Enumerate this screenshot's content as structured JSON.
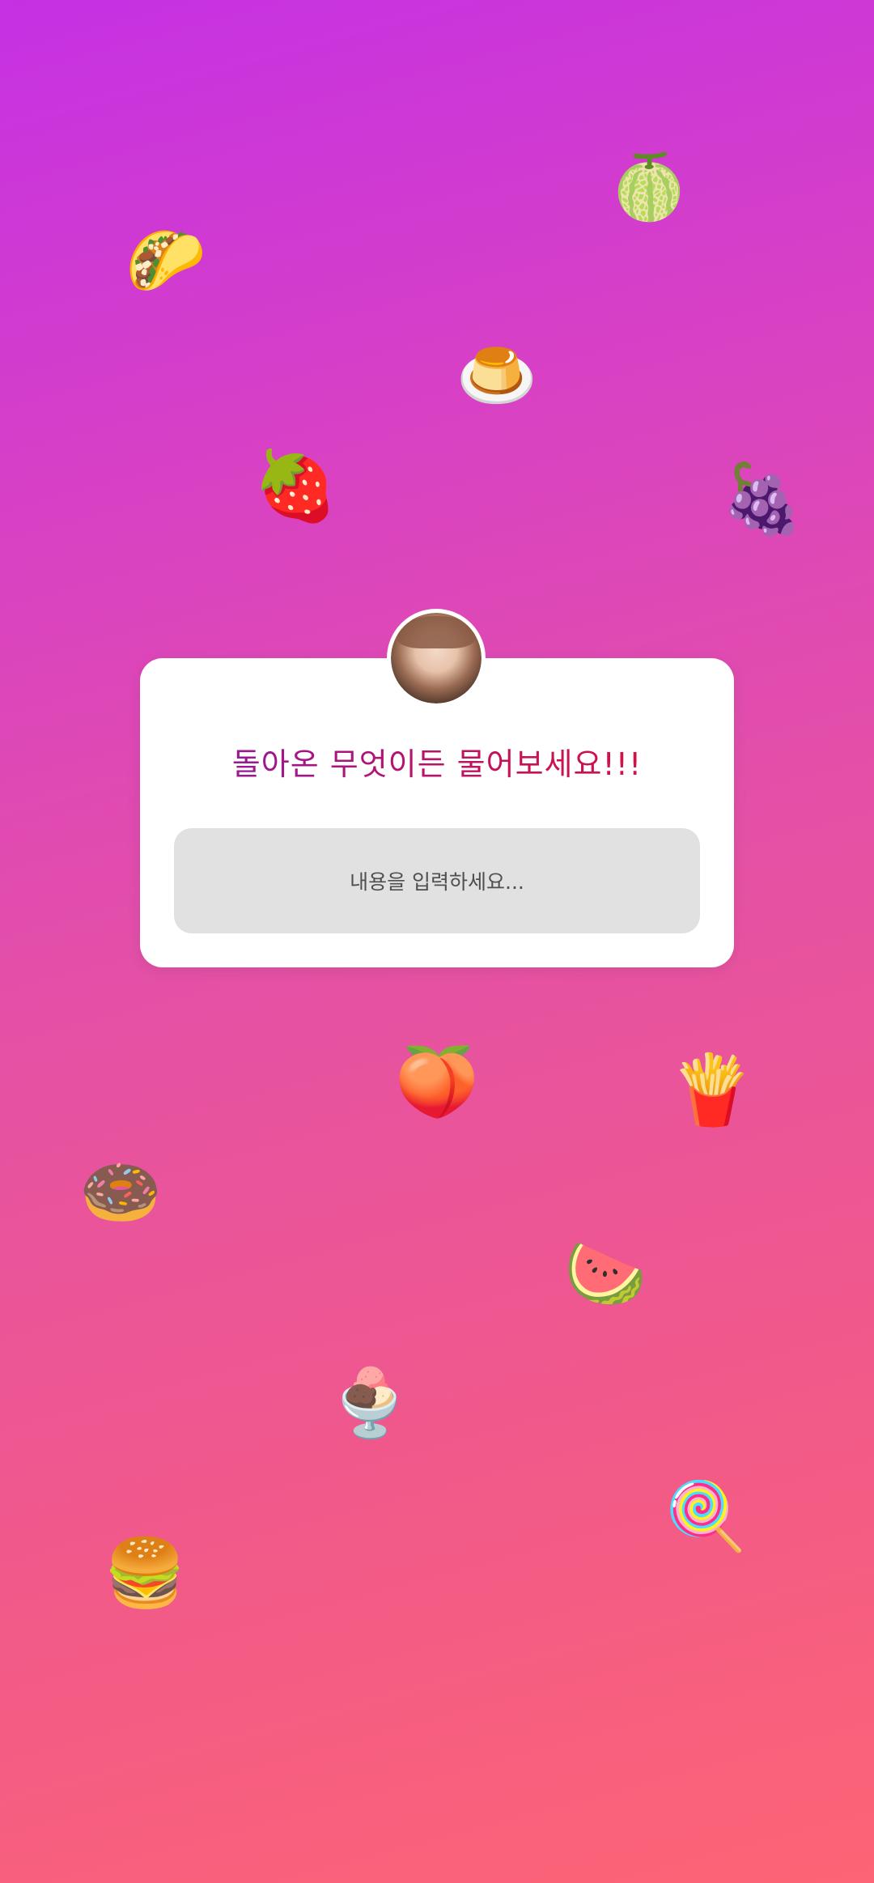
{
  "question_card": {
    "title": "돌아온 무엇이든 물어보세요!!!",
    "input_placeholder": "내용을 입력하세요..."
  },
  "avatar": {
    "name": "avatar"
  },
  "decorations": [
    {
      "icon": "melon-emoji-icon",
      "glyph": "🍈"
    },
    {
      "icon": "taco-emoji-icon",
      "glyph": "🌮"
    },
    {
      "icon": "pudding-emoji-icon",
      "glyph": "🍮"
    },
    {
      "icon": "strawberry-emoji-icon",
      "glyph": "🍓"
    },
    {
      "icon": "grapes-emoji-icon",
      "glyph": "🍇"
    },
    {
      "icon": "peach-emoji-icon",
      "glyph": "🍑"
    },
    {
      "icon": "fries-emoji-icon",
      "glyph": "🍟"
    },
    {
      "icon": "donut-emoji-icon",
      "glyph": "🍩"
    },
    {
      "icon": "watermelon-emoji-icon",
      "glyph": "🍉"
    },
    {
      "icon": "icecream-emoji-icon",
      "glyph": "🍨"
    },
    {
      "icon": "lollipop-emoji-icon",
      "glyph": "🍭"
    },
    {
      "icon": "burger-emoji-icon",
      "glyph": "🍔"
    }
  ],
  "colors": {
    "gradient_top": "#c531e3",
    "gradient_bottom": "#fd6475",
    "title_start": "#8a1aa8",
    "title_end": "#d6143c",
    "input_bg": "#e1e1e1"
  }
}
